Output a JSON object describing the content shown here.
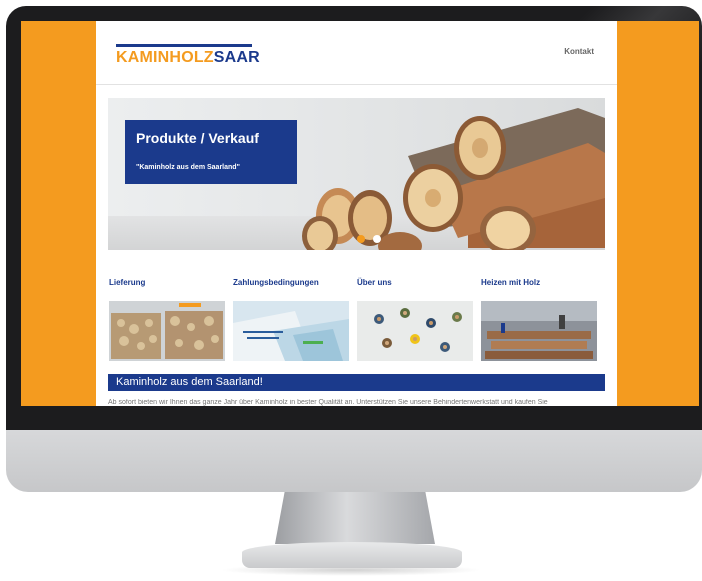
{
  "site": {
    "logo": {
      "part1": "KAMINHOLZ",
      "part2": "SAAR"
    },
    "nav": {
      "contact": "Kontakt"
    },
    "hero": {
      "title": "Produkte / Verkauf",
      "subtitle": "\"Kaminholz aus dem Saarland\"",
      "slides": 2,
      "active_slide": 1
    },
    "categories": [
      {
        "label": "Lieferung",
        "image": "firewood-crates-image"
      },
      {
        "label": "Zahlungsbedingungen",
        "image": "invoices-image"
      },
      {
        "label": "Über uns",
        "image": "workers-aerial-image"
      },
      {
        "label": "Heizen mit Holz",
        "image": "logs-workshop-image"
      }
    ],
    "section": {
      "title": "Kaminholz aus dem Saarland!",
      "body": "Ab sofort bieten wir Ihnen das ganze Jahr über Kaminholz in bester Qualität an. Unterstützen Sie unsere Behindertenwerkstatt und kaufen Sie"
    }
  },
  "colors": {
    "accent_orange": "#f49b1f",
    "brand_blue": "#1b3a8c",
    "bezel": "#1c1c1e"
  }
}
